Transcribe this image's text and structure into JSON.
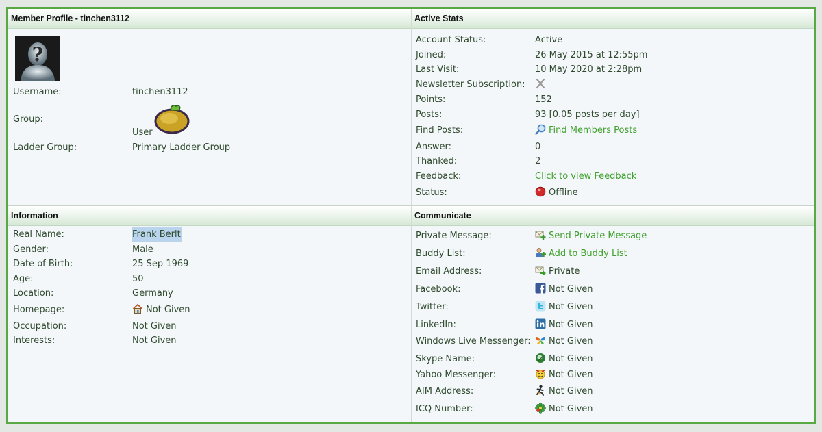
{
  "profile": {
    "header": "Member Profile - tinchen3112",
    "rows": [
      {
        "label": "Username:",
        "value": "tinchen3112"
      },
      {
        "label": "Group:",
        "value": "User"
      },
      {
        "label": "Ladder Group:",
        "value": "Primary Ladder Group"
      }
    ]
  },
  "stats": {
    "header": "Active Stats",
    "rows": [
      {
        "label": "Account Status:",
        "value": "Active"
      },
      {
        "label": "Joined:",
        "value": "26 May 2015 at 12:55pm"
      },
      {
        "label": "Last Visit:",
        "value": "10 May 2020 at 2:28pm"
      },
      {
        "label": "Newsletter Subscription:",
        "value": ""
      },
      {
        "label": "Points:",
        "value": "152"
      },
      {
        "label": "Posts:",
        "value": "93 [0.05 posts per day]"
      },
      {
        "label": "Find Posts:",
        "value": "Find Members Posts"
      },
      {
        "label": "Answer:",
        "value": "0"
      },
      {
        "label": "Thanked:",
        "value": "2"
      },
      {
        "label": "Feedback:",
        "value": "Click to view Feedback"
      },
      {
        "label": "Status:",
        "value": "Offline"
      }
    ]
  },
  "information": {
    "header": "Information",
    "rows": [
      {
        "label": "Real Name:",
        "value": "Frank Berlt"
      },
      {
        "label": "Gender:",
        "value": "Male"
      },
      {
        "label": "Date of Birth:",
        "value": "25 Sep 1969"
      },
      {
        "label": "Age:",
        "value": "50"
      },
      {
        "label": "Location:",
        "value": "Germany"
      },
      {
        "label": "Homepage:",
        "value": "Not Given"
      },
      {
        "label": "Occupation:",
        "value": "Not Given"
      },
      {
        "label": "Interests:",
        "value": "Not Given"
      }
    ]
  },
  "communicate": {
    "header": "Communicate",
    "rows": [
      {
        "label": "Private Message:",
        "value": "Send Private Message"
      },
      {
        "label": "Buddy List:",
        "value": "Add to Buddy List"
      },
      {
        "label": "Email Address:",
        "value": "Private"
      },
      {
        "label": "Facebook:",
        "value": "Not Given"
      },
      {
        "label": "Twitter:",
        "value": "Not Given"
      },
      {
        "label": "LinkedIn:",
        "value": "Not Given"
      },
      {
        "label": "Windows Live Messenger:",
        "value": "Not Given"
      },
      {
        "label": "Skype Name:",
        "value": "Not Given"
      },
      {
        "label": "Yahoo Messenger:",
        "value": "Not Given"
      },
      {
        "label": "AIM Address:",
        "value": "Not Given"
      },
      {
        "label": "ICQ Number:",
        "value": "Not Given"
      }
    ]
  },
  "colors": {
    "border": "#58a843",
    "link": "#3fa02e",
    "text": "#2f4a2f",
    "offline": "#d22a2a"
  },
  "icons": [
    "avatar-silhouette-icon",
    "orange-group-icon",
    "x-mark-icon",
    "magnifier-icon",
    "red-dot-icon",
    "house-icon",
    "envelope-plus-icon",
    "buddy-plus-icon",
    "email-arrow-icon",
    "facebook-icon",
    "twitter-icon",
    "linkedin-icon",
    "butterfly-icon",
    "skype-icon",
    "yahoo-icon",
    "aim-icon",
    "icq-icon"
  ]
}
